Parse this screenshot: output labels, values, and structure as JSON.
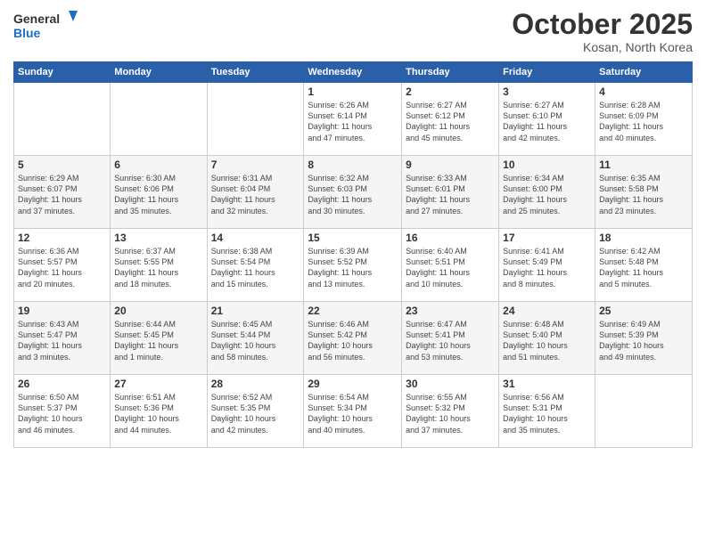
{
  "header": {
    "logo_general": "General",
    "logo_blue": "Blue",
    "month": "October 2025",
    "location": "Kosan, North Korea"
  },
  "weekdays": [
    "Sunday",
    "Monday",
    "Tuesday",
    "Wednesday",
    "Thursday",
    "Friday",
    "Saturday"
  ],
  "weeks": [
    [
      {
        "day": "",
        "info": ""
      },
      {
        "day": "",
        "info": ""
      },
      {
        "day": "",
        "info": ""
      },
      {
        "day": "1",
        "info": "Sunrise: 6:26 AM\nSunset: 6:14 PM\nDaylight: 11 hours\nand 47 minutes."
      },
      {
        "day": "2",
        "info": "Sunrise: 6:27 AM\nSunset: 6:12 PM\nDaylight: 11 hours\nand 45 minutes."
      },
      {
        "day": "3",
        "info": "Sunrise: 6:27 AM\nSunset: 6:10 PM\nDaylight: 11 hours\nand 42 minutes."
      },
      {
        "day": "4",
        "info": "Sunrise: 6:28 AM\nSunset: 6:09 PM\nDaylight: 11 hours\nand 40 minutes."
      }
    ],
    [
      {
        "day": "5",
        "info": "Sunrise: 6:29 AM\nSunset: 6:07 PM\nDaylight: 11 hours\nand 37 minutes."
      },
      {
        "day": "6",
        "info": "Sunrise: 6:30 AM\nSunset: 6:06 PM\nDaylight: 11 hours\nand 35 minutes."
      },
      {
        "day": "7",
        "info": "Sunrise: 6:31 AM\nSunset: 6:04 PM\nDaylight: 11 hours\nand 32 minutes."
      },
      {
        "day": "8",
        "info": "Sunrise: 6:32 AM\nSunset: 6:03 PM\nDaylight: 11 hours\nand 30 minutes."
      },
      {
        "day": "9",
        "info": "Sunrise: 6:33 AM\nSunset: 6:01 PM\nDaylight: 11 hours\nand 27 minutes."
      },
      {
        "day": "10",
        "info": "Sunrise: 6:34 AM\nSunset: 6:00 PM\nDaylight: 11 hours\nand 25 minutes."
      },
      {
        "day": "11",
        "info": "Sunrise: 6:35 AM\nSunset: 5:58 PM\nDaylight: 11 hours\nand 23 minutes."
      }
    ],
    [
      {
        "day": "12",
        "info": "Sunrise: 6:36 AM\nSunset: 5:57 PM\nDaylight: 11 hours\nand 20 minutes."
      },
      {
        "day": "13",
        "info": "Sunrise: 6:37 AM\nSunset: 5:55 PM\nDaylight: 11 hours\nand 18 minutes."
      },
      {
        "day": "14",
        "info": "Sunrise: 6:38 AM\nSunset: 5:54 PM\nDaylight: 11 hours\nand 15 minutes."
      },
      {
        "day": "15",
        "info": "Sunrise: 6:39 AM\nSunset: 5:52 PM\nDaylight: 11 hours\nand 13 minutes."
      },
      {
        "day": "16",
        "info": "Sunrise: 6:40 AM\nSunset: 5:51 PM\nDaylight: 11 hours\nand 10 minutes."
      },
      {
        "day": "17",
        "info": "Sunrise: 6:41 AM\nSunset: 5:49 PM\nDaylight: 11 hours\nand 8 minutes."
      },
      {
        "day": "18",
        "info": "Sunrise: 6:42 AM\nSunset: 5:48 PM\nDaylight: 11 hours\nand 5 minutes."
      }
    ],
    [
      {
        "day": "19",
        "info": "Sunrise: 6:43 AM\nSunset: 5:47 PM\nDaylight: 11 hours\nand 3 minutes."
      },
      {
        "day": "20",
        "info": "Sunrise: 6:44 AM\nSunset: 5:45 PM\nDaylight: 11 hours\nand 1 minute."
      },
      {
        "day": "21",
        "info": "Sunrise: 6:45 AM\nSunset: 5:44 PM\nDaylight: 10 hours\nand 58 minutes."
      },
      {
        "day": "22",
        "info": "Sunrise: 6:46 AM\nSunset: 5:42 PM\nDaylight: 10 hours\nand 56 minutes."
      },
      {
        "day": "23",
        "info": "Sunrise: 6:47 AM\nSunset: 5:41 PM\nDaylight: 10 hours\nand 53 minutes."
      },
      {
        "day": "24",
        "info": "Sunrise: 6:48 AM\nSunset: 5:40 PM\nDaylight: 10 hours\nand 51 minutes."
      },
      {
        "day": "25",
        "info": "Sunrise: 6:49 AM\nSunset: 5:39 PM\nDaylight: 10 hours\nand 49 minutes."
      }
    ],
    [
      {
        "day": "26",
        "info": "Sunrise: 6:50 AM\nSunset: 5:37 PM\nDaylight: 10 hours\nand 46 minutes."
      },
      {
        "day": "27",
        "info": "Sunrise: 6:51 AM\nSunset: 5:36 PM\nDaylight: 10 hours\nand 44 minutes."
      },
      {
        "day": "28",
        "info": "Sunrise: 6:52 AM\nSunset: 5:35 PM\nDaylight: 10 hours\nand 42 minutes."
      },
      {
        "day": "29",
        "info": "Sunrise: 6:54 AM\nSunset: 5:34 PM\nDaylight: 10 hours\nand 40 minutes."
      },
      {
        "day": "30",
        "info": "Sunrise: 6:55 AM\nSunset: 5:32 PM\nDaylight: 10 hours\nand 37 minutes."
      },
      {
        "day": "31",
        "info": "Sunrise: 6:56 AM\nSunset: 5:31 PM\nDaylight: 10 hours\nand 35 minutes."
      },
      {
        "day": "",
        "info": ""
      }
    ]
  ]
}
